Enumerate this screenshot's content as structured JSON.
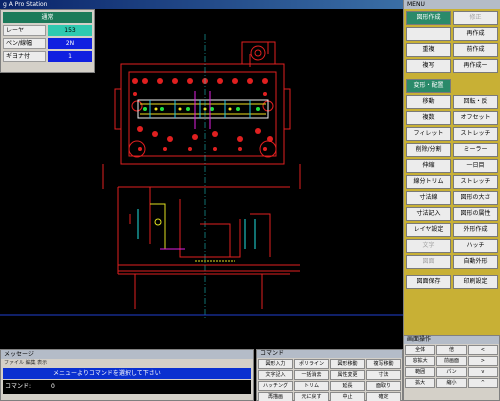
{
  "window": {
    "title": "g A Pro Station"
  },
  "layer_panel": {
    "header": "通常",
    "rows": [
      {
        "label": "レーヤ",
        "value": "153",
        "color": "#2ec9b0"
      },
      {
        "label": "ペン/線幅",
        "value": "2N",
        "color": "#1020e0"
      },
      {
        "label": "ギヨナ付",
        "value": "1",
        "color": "#1020e0"
      }
    ]
  },
  "menu_panel": {
    "title": "MENU",
    "rows": [
      [
        "図形作成",
        "修正"
      ],
      [
        "",
        "再作成"
      ],
      [
        "重複",
        "前作成"
      ],
      [
        "複写",
        "再作成ー"
      ],
      [
        "変形・配置",
        ""
      ],
      [
        "移動",
        "回転・反"
      ],
      [
        "複数",
        "オフセット"
      ],
      [
        "フィレット",
        "ストレッチ"
      ],
      [
        "削除/分割",
        "ミーラー"
      ],
      [
        "伸縮",
        "一日目"
      ],
      [
        "線分トリム",
        "ストレッチ"
      ],
      [
        "寸法線",
        "図形の大さ"
      ],
      [
        "寸法記入",
        "図形の属性"
      ],
      [
        "レイヤ設定",
        "外形作成"
      ],
      [
        "文字",
        "ハッチ"
      ],
      [
        "図面",
        "自動外形"
      ],
      [
        "図面保存",
        "印刷設定"
      ]
    ]
  },
  "small_panel": {
    "title": "画面操作",
    "rows": [
      [
        "全体",
        "倍",
        "<"
      ],
      [
        "窓拡大",
        "前画面",
        ">"
      ],
      [
        "範囲",
        "パン",
        "v"
      ],
      [
        "拡大",
        "縮小",
        "^"
      ]
    ]
  },
  "message_panel": {
    "title": "メッセージ",
    "menu": "ファイル 編集 表示",
    "message": "メニューよりコマンドを選択して下さい",
    "command_label": "コマンド:",
    "command_value": "0"
  },
  "cmd_panel": {
    "title": "コマンド",
    "rows": [
      [
        "図形入力",
        "ポリライン",
        "図形移動",
        "複写移動"
      ],
      [
        "文字記入",
        "一括消去",
        "属性変更",
        "寸法"
      ],
      [
        "ハッチング",
        "トリム",
        "延長",
        "面取り"
      ],
      [
        "再描画",
        "元に戻す",
        "中止",
        "確定"
      ]
    ]
  }
}
